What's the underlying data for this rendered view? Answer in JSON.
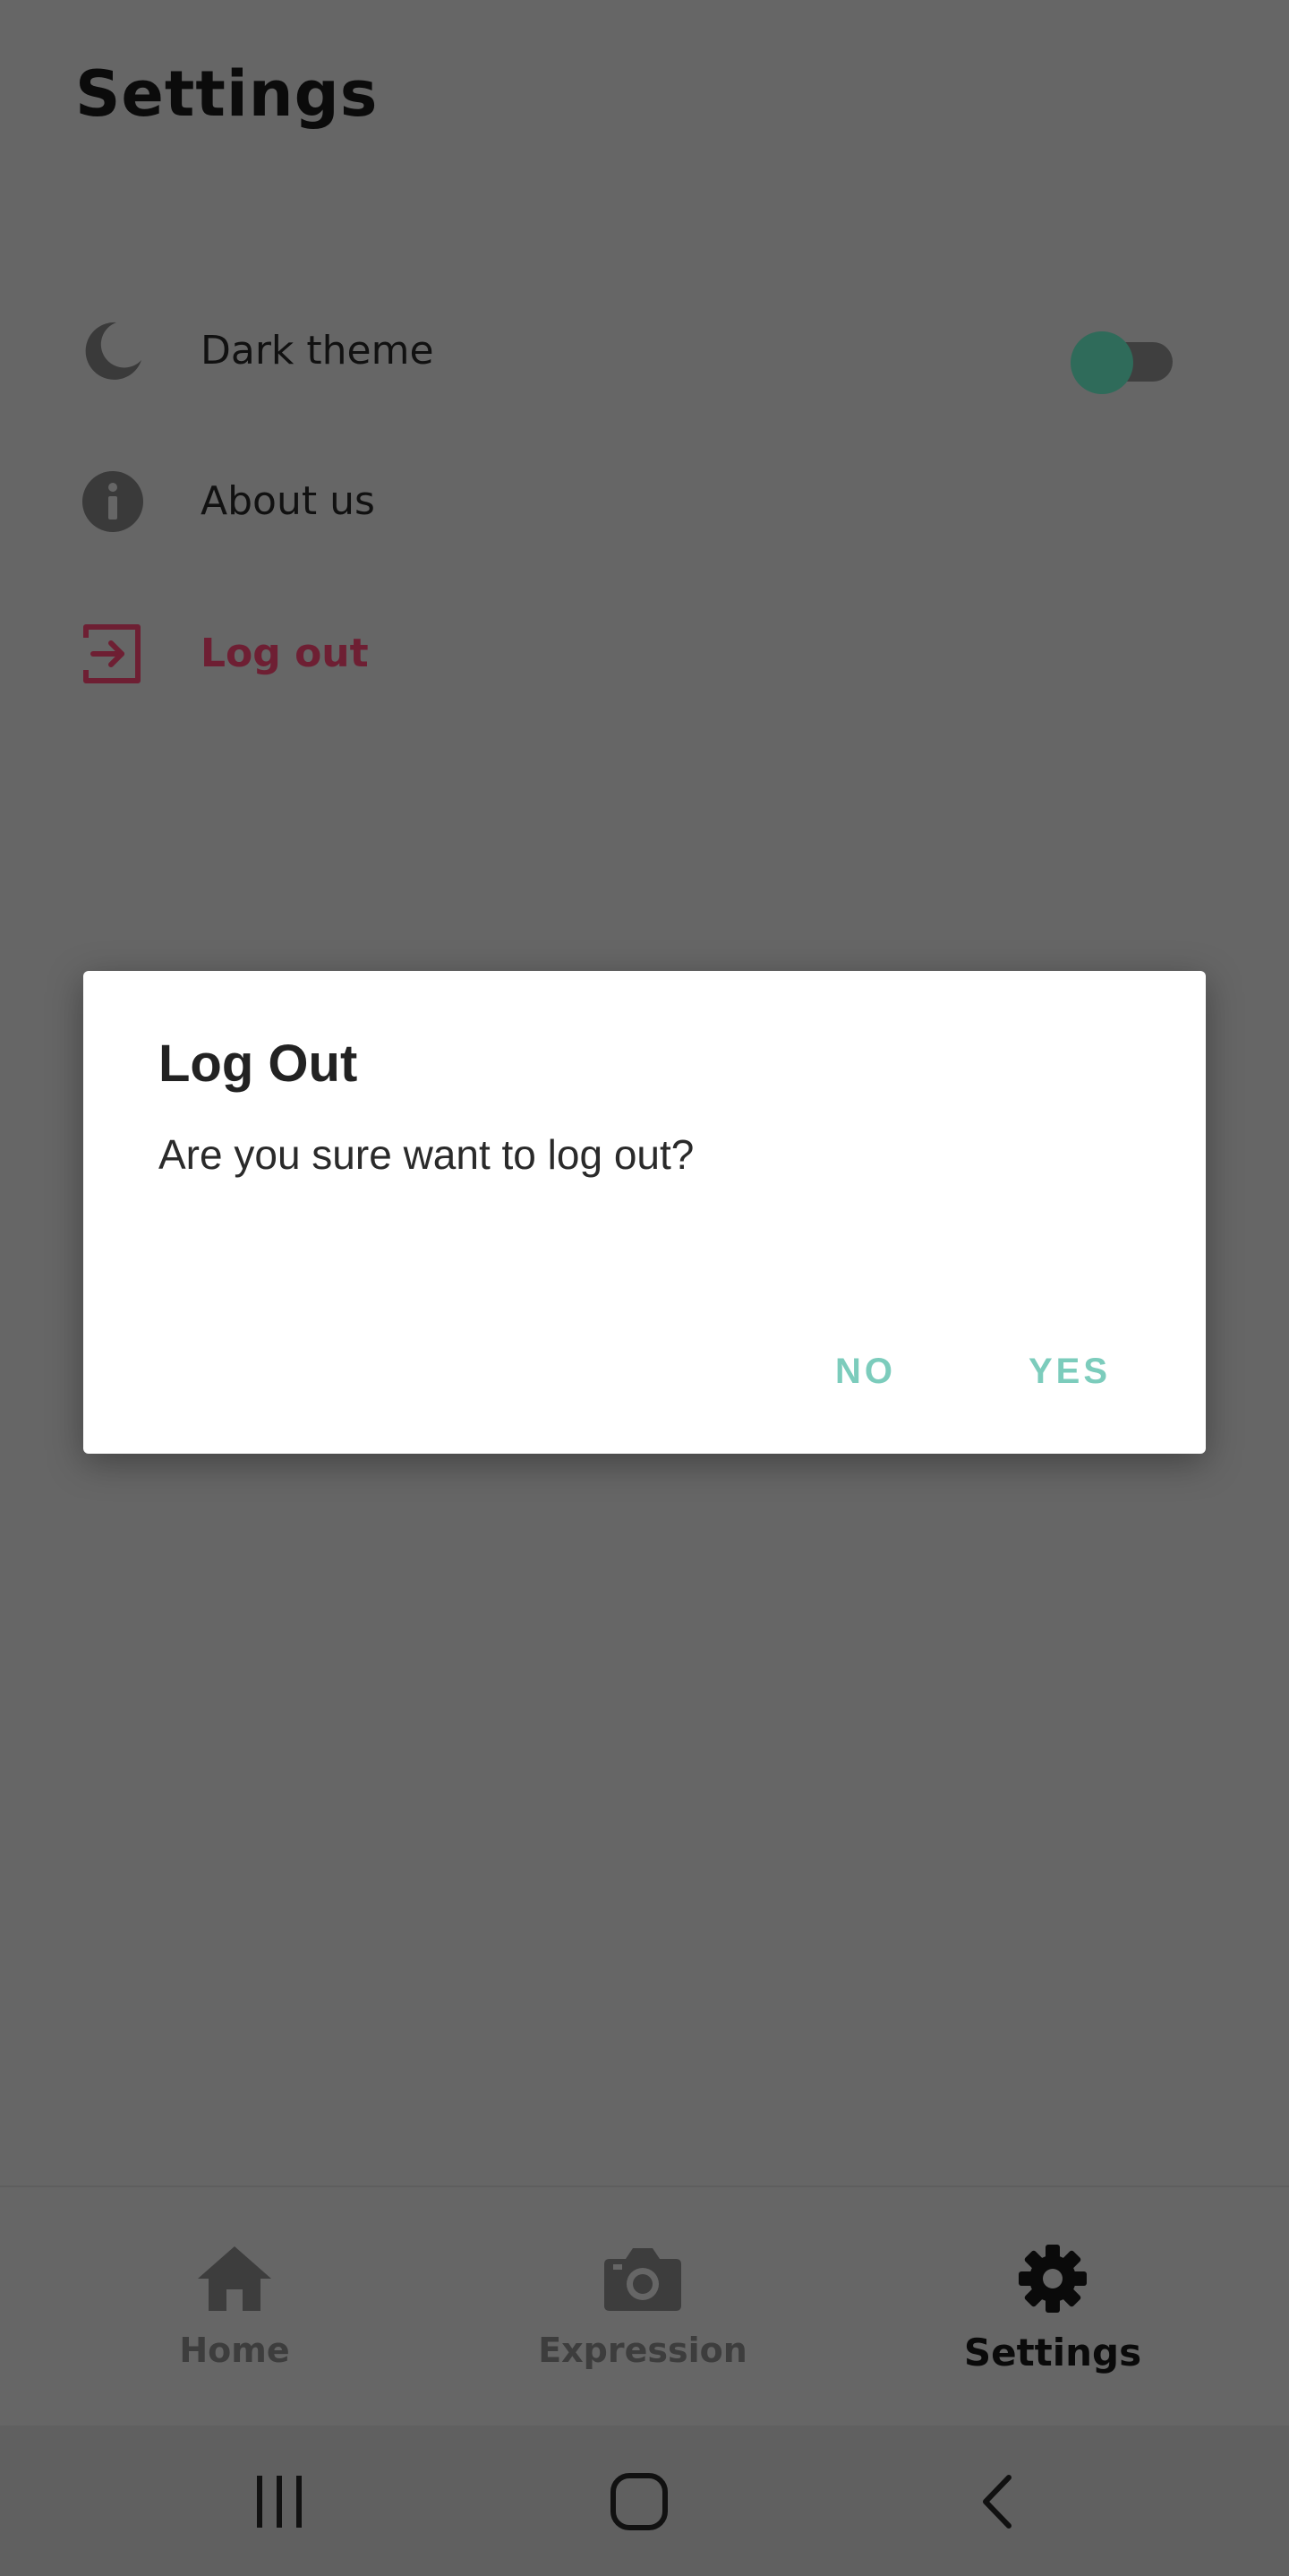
{
  "page": {
    "title": "Settings"
  },
  "settings": {
    "items": [
      {
        "label": "Dark theme",
        "icon": "moon-icon",
        "toggle_on": true
      },
      {
        "label": "About us",
        "icon": "info-icon"
      },
      {
        "label": "Log out",
        "icon": "logout-icon"
      }
    ]
  },
  "dialog": {
    "title": "Log Out",
    "message": "Are you sure want to log out?",
    "no_label": "NO",
    "yes_label": "YES"
  },
  "bottom_nav": {
    "items": [
      {
        "label": "Home",
        "icon": "home-icon"
      },
      {
        "label": "Expression",
        "icon": "camera-icon"
      },
      {
        "label": "Settings",
        "icon": "gear-icon",
        "active": true
      }
    ]
  },
  "system_nav": {
    "items": [
      "recents-icon",
      "home-circle-icon",
      "back-icon"
    ]
  },
  "colors": {
    "scrim": "#666666",
    "accent": "#7cccbc",
    "logout": "#6e1f33",
    "toggle_knob": "#2f6b5a"
  }
}
